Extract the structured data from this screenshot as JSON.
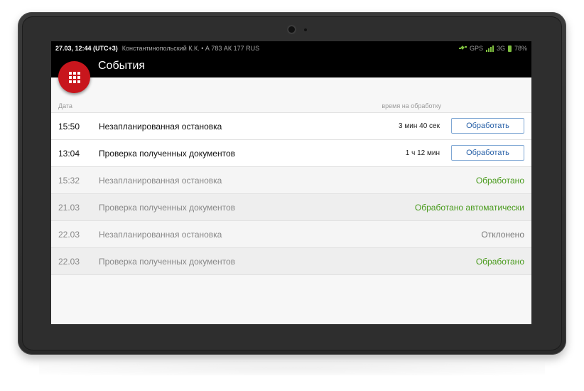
{
  "statusbar": {
    "time": "27.03, 12:44 (UTC+3)",
    "driver": "Константинопольский К.К. • А 783 АК 177 RUS",
    "gps": "GPS",
    "network": "3G",
    "battery": "78%",
    "accent": "#7fbf3f"
  },
  "actionbar": {
    "title": "События",
    "fab_icon": "grid-icon",
    "fab_color": "#c8161d"
  },
  "columns": {
    "date": "Дата",
    "processing_time": "время на обработку"
  },
  "events": [
    {
      "date": "15:50",
      "name": "Незапланированная остановка",
      "remaining": "3 мин 40 сек",
      "action": "Обработать"
    },
    {
      "date": "13:04",
      "name": "Проверка полученных документов",
      "remaining": "1 ч 12 мин",
      "action": "Обработать"
    },
    {
      "date": "15:32",
      "name": "Незапланированная остановка",
      "status": "Обработано"
    },
    {
      "date": "21.03",
      "name": "Проверка полученных документов",
      "status": "Обработано автоматически"
    },
    {
      "date": "22.03",
      "name": "Незапланированная остановка",
      "status": "Отклонено"
    },
    {
      "date": "22.03",
      "name": "Проверка полученных документов",
      "status": "Обработано"
    }
  ]
}
